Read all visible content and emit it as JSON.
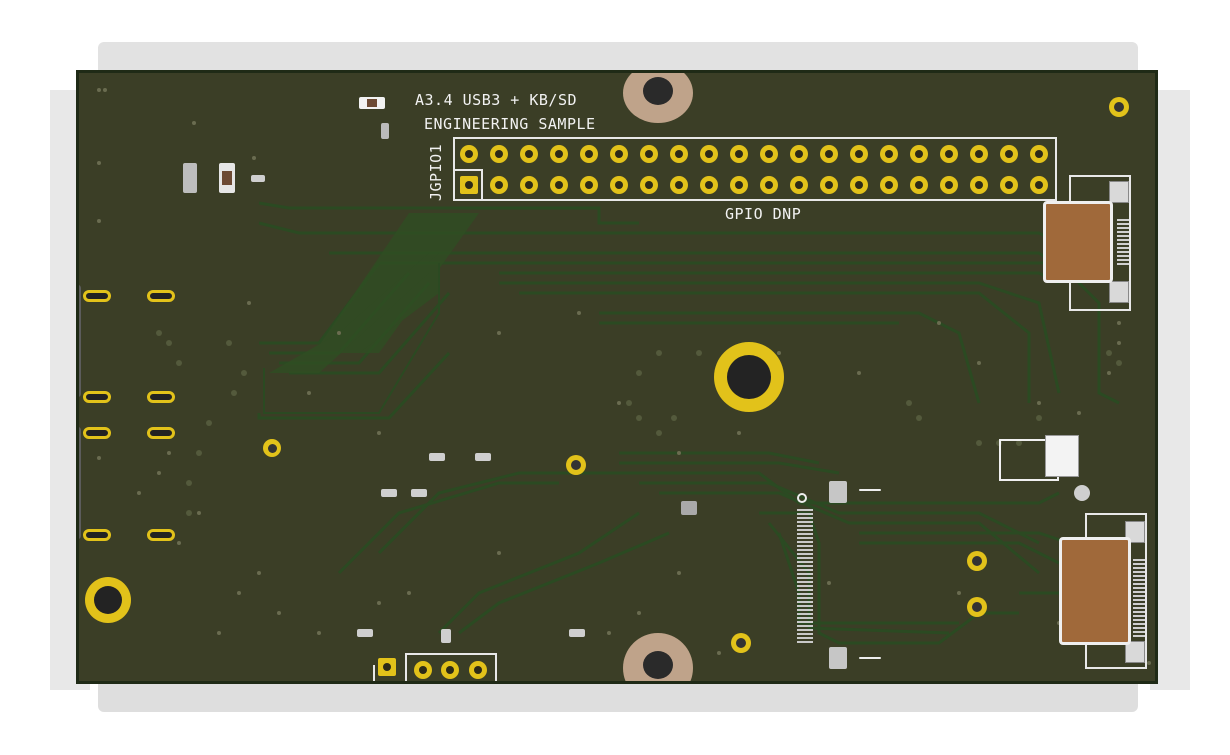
{
  "board": {
    "title_line1": "A3.4 USB3 + KB/SD",
    "title_line2": "ENGINEERING SAMPLE",
    "gpio_label": "GPIO DNP",
    "gpio_ref": "JGPIO1"
  },
  "colors": {
    "soldermask": "#3b3e26",
    "copper_trace": "#2a4520",
    "pad_gold": "#e2c21a",
    "silkscreen": "#f2f2f2",
    "connector_brown": "#a0693a"
  },
  "icons": {
    "mounting_hole": "mounting-hole-icon",
    "pin": "pin-header-icon",
    "ffc_connector": "ffc-connector-icon"
  }
}
